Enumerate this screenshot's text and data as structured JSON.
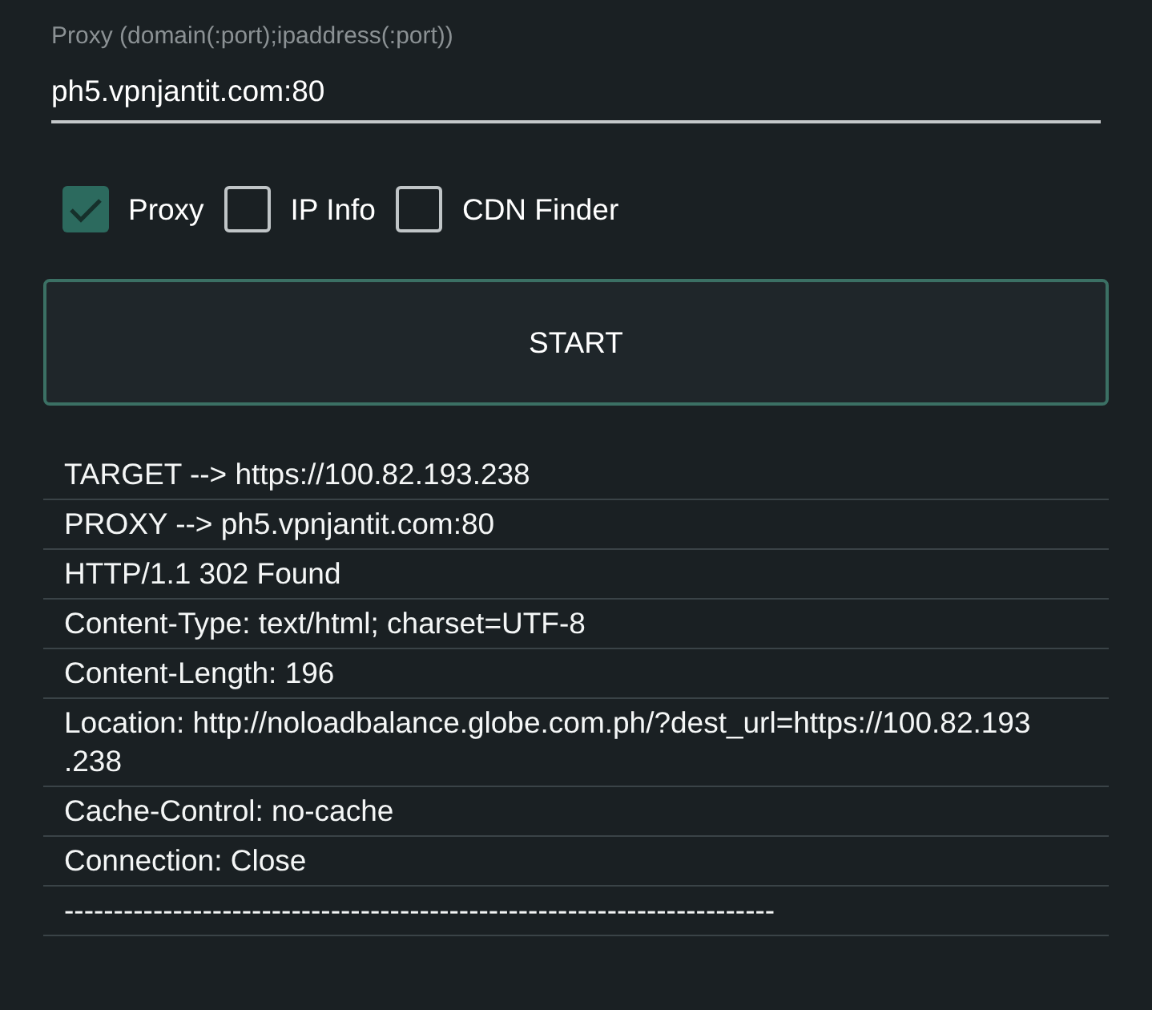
{
  "proxy_field": {
    "label": "Proxy (domain(:port);ipaddress(:port))",
    "value": "ph5.vpnjantit.com:80"
  },
  "options": [
    {
      "label": "Proxy",
      "checked": true
    },
    {
      "label": "IP Info",
      "checked": false
    },
    {
      "label": "CDN Finder",
      "checked": false
    }
  ],
  "start_button": {
    "label": "START"
  },
  "log": [
    {
      "text": "TARGET --> https://100.82.193.238"
    },
    {
      "text": "PROXY --> ph5.vpnjantit.com:80"
    },
    {
      "text": "HTTP/1.1 302 Found"
    },
    {
      "text": "Content-Type: text/html; charset=UTF-8"
    },
    {
      "text": "Content-Length: 196"
    },
    {
      "text": "Location: http://noloadbalance.globe.com.ph/?dest_url=https://100.82.193\n.238"
    },
    {
      "text": "Cache-Control: no-cache"
    },
    {
      "text": "Connection: Close"
    },
    {
      "text": "------------------------------------------------------------------------"
    }
  ]
}
